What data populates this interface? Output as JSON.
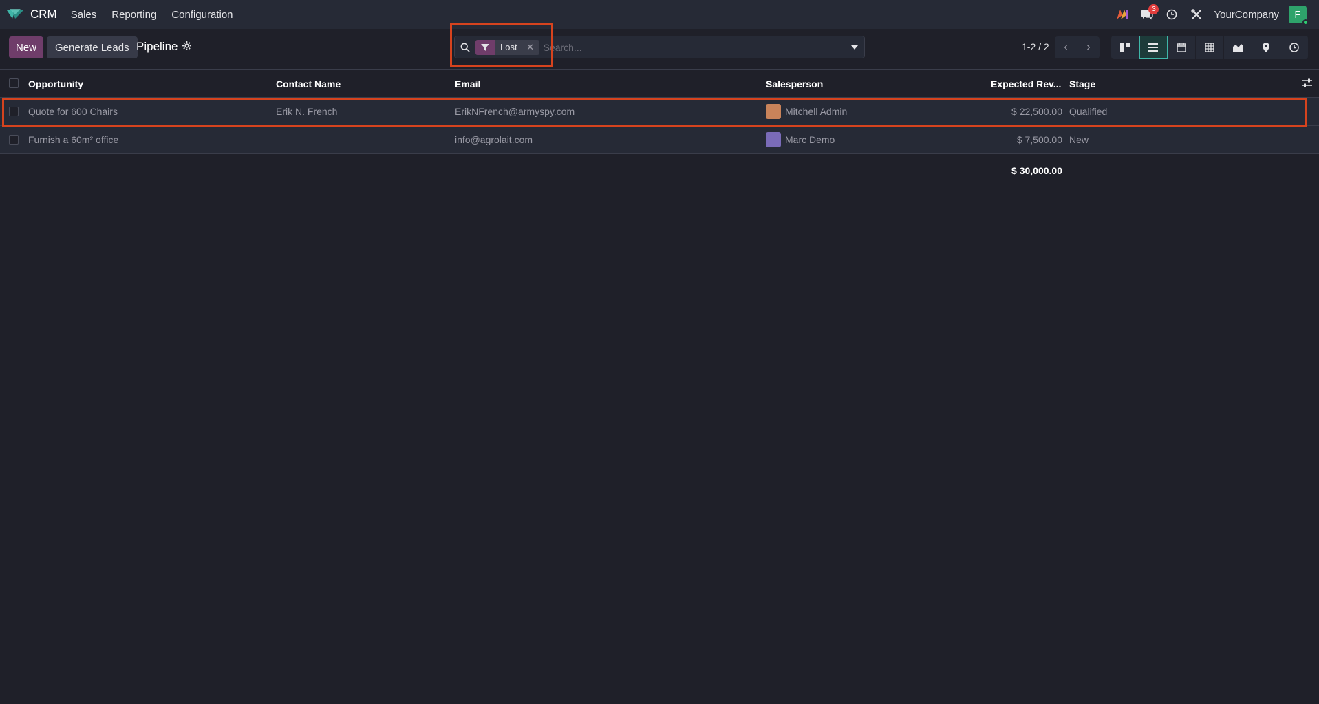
{
  "navbar": {
    "app_name": "CRM",
    "menu": [
      "Sales",
      "Reporting",
      "Configuration"
    ],
    "messages_count": "3",
    "company": "YourCompany",
    "user_initial": "F"
  },
  "control_panel": {
    "new_label": "New",
    "generate_leads_label": "Generate Leads",
    "title": "Pipeline",
    "search": {
      "facet_label": "Lost",
      "placeholder": "Search..."
    },
    "pager": "1-2 / 2",
    "views": [
      "kanban-icon",
      "list-icon",
      "calendar-icon",
      "pivot-icon",
      "graph-icon",
      "map-icon",
      "activity-icon"
    ],
    "active_view": "list-icon"
  },
  "table": {
    "headers": [
      "Opportunity",
      "Contact Name",
      "Email",
      "Salesperson",
      "Expected Rev...",
      "Stage"
    ],
    "rows": [
      {
        "opportunity": "Quote for 600 Chairs",
        "contact": "Erik N. French",
        "email": "ErikNFrench@armyspy.com",
        "salesperson": "Mitchell Admin",
        "revenue": "$ 22,500.00",
        "stage": "Qualified"
      },
      {
        "opportunity": "Furnish a 60m² office",
        "contact": "",
        "email": "info@agrolait.com",
        "salesperson": "Marc Demo",
        "revenue": "$ 7,500.00",
        "stage": "New"
      }
    ],
    "total_revenue": "$ 30,000.00"
  },
  "colors": {
    "background": "#1f2029",
    "navbar": "#262a36",
    "primary": "#6f3d6a",
    "highlight": "#d6431e",
    "active_view": "#3fb6a8"
  }
}
